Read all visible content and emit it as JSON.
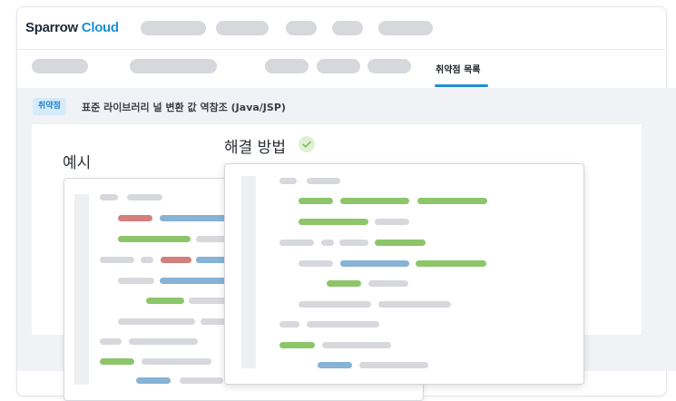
{
  "header": {
    "brand_primary": "Sparrow",
    "brand_accent": "Cloud",
    "brand_color": "#1e90d6"
  },
  "tabs": {
    "active_label": "취약점 목록",
    "accent_color": "#1e8fd5"
  },
  "vulnerability": {
    "badge": "취약점",
    "title": "표준 라이브러리 널 변환 값 역참조 (Java/JSP)"
  },
  "example": {
    "label": "예시"
  },
  "solution": {
    "label": "해결 방법",
    "status_icon": "check-circle-icon"
  }
}
